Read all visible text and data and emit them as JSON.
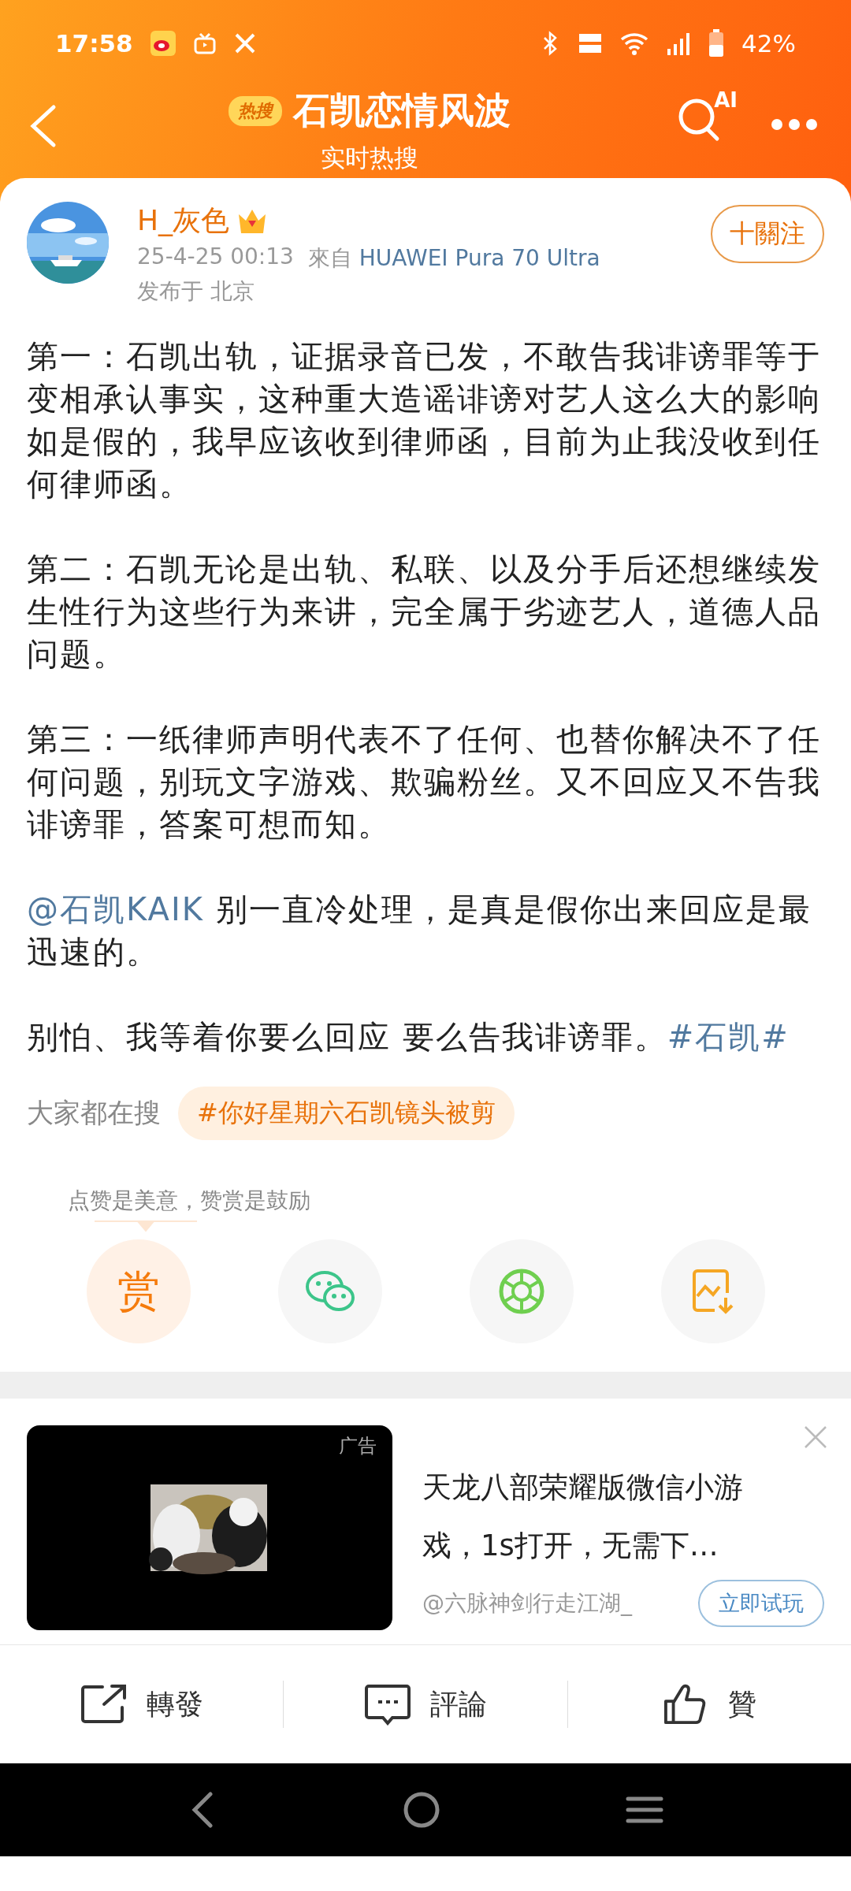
{
  "status_bar": {
    "time": "17:58",
    "battery": "42%"
  },
  "header": {
    "badge": "热搜",
    "title": "石凯恋情风波",
    "subtitle": "实时热搜",
    "ai_label": "AI"
  },
  "post": {
    "author": "H_灰色",
    "follow": "十關注",
    "timestamp": "25-4-25 00:13",
    "source_prefix": "來自",
    "source": "HUAWEI Pura 70 Ultra",
    "location": "发布于 北京",
    "paragraphs": [
      {
        "text": "第一：石凯出轨，证据录音已发，不敢告我诽谤罪等于变相承认事实，这种重大造谣诽谤对艺人这么大的影响如是假的，我早应该收到律师函，目前为止我没收到任何律师函。"
      },
      {
        "text": "第二：石凯无论是出轨、私联、以及分手后还想继续发生性行为这些行为来讲，完全属于劣迹艺人，道德人品问题。"
      },
      {
        "text": "第三：一纸律师声明代表不了任何、也替你解决不了任何问题，别玩文字游戏、欺骗粉丝。又不回应又不告我诽谤罪，答案可想而知。"
      },
      {
        "mention": "@石凯KAIK",
        "text": " 别一直冷处理，是真是假你出来回应是最迅速的。"
      },
      {
        "text": "别怕、我等着你要么回应 要么告我诽谤罪。",
        "hashtag": "#石凯#"
      }
    ],
    "trending_label": "大家都在搜",
    "trending_tag": "#你好星期六石凯镜头被剪",
    "reward_hint": "点赞是美意，赞赏是鼓励",
    "reward_button": "赏"
  },
  "ad": {
    "label": "广告",
    "title": "天龙八部荣耀版微信小游戏，1s打开，无需下…",
    "advertiser": "@六脉神剑行走江湖_",
    "cta": "立即试玩"
  },
  "actions": [
    {
      "kind": "repost",
      "label": "轉發"
    },
    {
      "kind": "comment",
      "label": "評論"
    },
    {
      "kind": "like",
      "label": "贊"
    }
  ]
}
